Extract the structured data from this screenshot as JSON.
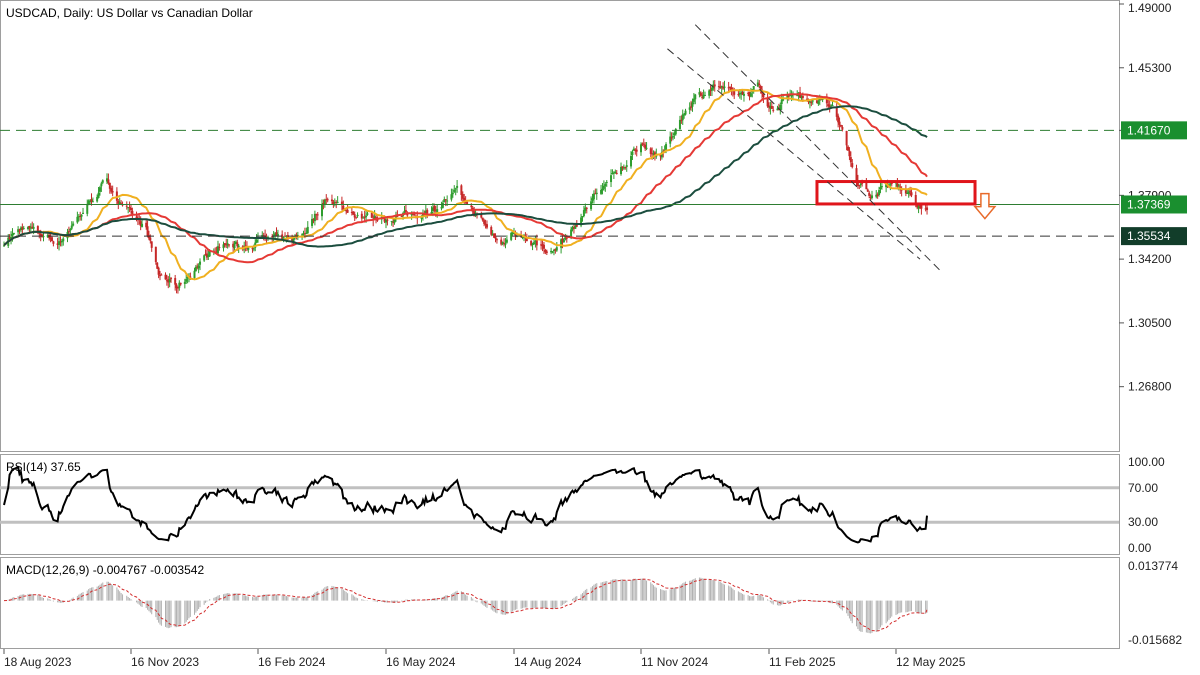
{
  "header": {
    "title": "USDCAD, Daily:  US Dollar vs Canadian Dollar"
  },
  "colors": {
    "bull": "#2e9d2e",
    "bear": "#c62828",
    "ma_fast": "#f0b020",
    "ma_mid": "#e53935",
    "ma_slow": "#1b4d3e",
    "level_line": "#2e7d32",
    "box": "#e0151b",
    "arrow": "#e86a2a",
    "tag_green": "#1a8f2f",
    "tag_dark": "#123d2a"
  },
  "chart_data": [
    {
      "type": "line",
      "panel": "price",
      "title": "USDCAD, Daily:  US Dollar vs Canadian Dollar",
      "y_ticks": [
        "1.49000",
        "1.45300",
        "1.41670",
        "1.37900",
        "1.34200",
        "1.30500",
        "1.26800"
      ],
      "ylim": [
        1.233,
        1.49
      ],
      "x_tick_labels": [
        "18 Aug 2023",
        "16 Nov 2023",
        "16 Feb 2024",
        "16 May 2024",
        "14 Aug 2024",
        "11 Nov 2024",
        "11 Feb 2025",
        "12 May 2025"
      ],
      "grid": false,
      "horizontal_levels": [
        {
          "value": 1.4167,
          "label": "1.41670",
          "style": "dashed"
        },
        {
          "value": 1.37369,
          "label": "1.37369",
          "style": "solid"
        },
        {
          "value": 1.35534,
          "label": "1.35534",
          "style": "dashed"
        }
      ],
      "price_anchor_dates": [
        "2023-08-18",
        "2023-09-01",
        "2023-09-26",
        "2023-10-13",
        "2023-10-30",
        "2023-11-10",
        "2023-11-27",
        "2023-12-06",
        "2023-12-20",
        "2024-01-05",
        "2024-01-20",
        "2024-02-05",
        "2024-02-20",
        "2024-03-10",
        "2024-03-20",
        "2024-04-05",
        "2024-04-18",
        "2024-05-05",
        "2024-05-20",
        "2024-06-05",
        "2024-06-20",
        "2024-07-05",
        "2024-07-20",
        "2024-08-05",
        "2024-08-14",
        "2024-08-26",
        "2024-09-10",
        "2024-09-25",
        "2024-10-10",
        "2024-10-28",
        "2024-11-11",
        "2024-11-25",
        "2024-12-10",
        "2024-12-20",
        "2025-01-05",
        "2025-01-15",
        "2025-01-28",
        "2025-02-03",
        "2025-02-14",
        "2025-02-28",
        "2025-03-07",
        "2025-03-15",
        "2025-03-28",
        "2025-04-04",
        "2025-04-14",
        "2025-04-24",
        "2025-05-03",
        "2025-05-12",
        "2025-05-21",
        "2025-05-28",
        "2025-06-03"
      ],
      "price_anchor_values": [
        1.352,
        1.361,
        1.352,
        1.37,
        1.388,
        1.372,
        1.359,
        1.333,
        1.326,
        1.34,
        1.351,
        1.349,
        1.354,
        1.353,
        1.358,
        1.379,
        1.37,
        1.366,
        1.366,
        1.368,
        1.372,
        1.381,
        1.366,
        1.35,
        1.359,
        1.352,
        1.346,
        1.36,
        1.38,
        1.394,
        1.41,
        1.4,
        1.425,
        1.436,
        1.443,
        1.437,
        1.438,
        1.442,
        1.428,
        1.44,
        1.435,
        1.436,
        1.43,
        1.415,
        1.387,
        1.38,
        1.383,
        1.387,
        1.38,
        1.373,
        1.3737
      ],
      "series": [
        {
          "name": "",
          "role": "moving-average-fast"
        },
        {
          "name": "",
          "role": "moving-average-mid"
        },
        {
          "name": "",
          "role": "moving-average-slow"
        }
      ],
      "annotations": [
        "rectangle zone between 1.3740 and 1.3870 from mid-March to early July 2025",
        "descending parallel channel lines from Dec 2024 to Jun 2025",
        "downward arrow to the right of the zone"
      ]
    },
    {
      "type": "line",
      "panel": "rsi",
      "title": "RSI(14) 37.65",
      "y_ticks": [
        "100.00",
        "70.00",
        "30.00",
        "0.00"
      ],
      "ylim": [
        0,
        100
      ],
      "levels": [
        70,
        30
      ],
      "last_value": 37.65
    },
    {
      "type": "bar",
      "panel": "macd",
      "title": "MACD(12,26,9) -0.004767 -0.003542",
      "y_ticks": [
        "0.013774",
        "-0.015682"
      ],
      "ylim": [
        -0.015682,
        0.013774
      ],
      "macd_last": -0.004767,
      "signal_last": -0.003542
    }
  ]
}
